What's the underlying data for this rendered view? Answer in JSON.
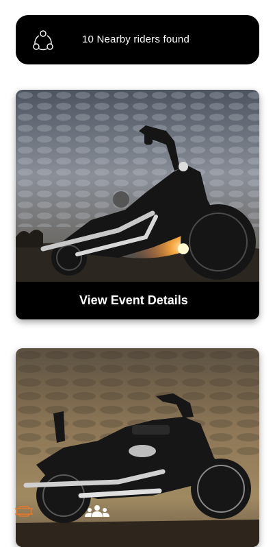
{
  "banner": {
    "text": "10 Nearby riders found",
    "icon": "nearby-riders-icon"
  },
  "events": [
    {
      "button_label": "View Event Details",
      "image": "motorcycle-sunset-photo"
    },
    {
      "image": "motorcycle-cloudy-photo"
    }
  ],
  "bottom_nav": {
    "items": [
      {
        "icon": "harley-logo-icon",
        "color": "#E8782A",
        "active": true
      },
      {
        "icon": "group-riders-icon",
        "color": "#FFFFFF",
        "active": false
      }
    ]
  },
  "colors": {
    "banner_bg": "#000000",
    "accent": "#E8782A"
  }
}
